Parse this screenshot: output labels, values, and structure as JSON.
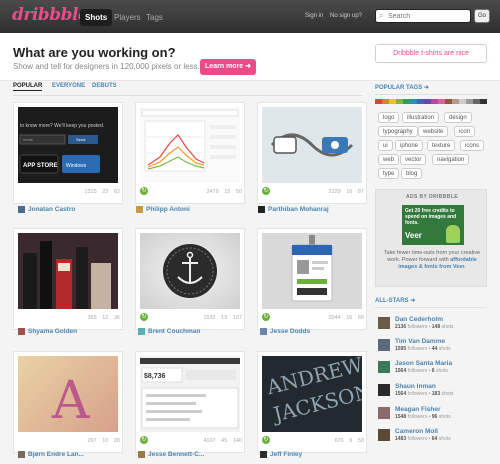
{
  "header": {
    "logo": "dribbble",
    "nav": [
      "Shots",
      "Players",
      "Tags"
    ],
    "sign_in": "Sign in",
    "no_signup": "No sign up?",
    "search_placeholder": "Search",
    "go_label": "Go"
  },
  "hero": {
    "title": "What are you working on?",
    "subtitle": "Show and tell for designers in 120,000 pixels or less.",
    "button": "Learn more ➜",
    "tshirts": "Dribbble t-shirts are nice"
  },
  "tabs": [
    "POPULAR",
    "EVERYONE",
    "DEBUTS"
  ],
  "shots": [
    {
      "views": "1325",
      "comments": "23",
      "likes": "62",
      "player": "Jonatan Castro"
    },
    {
      "views": "2479",
      "comments": "15",
      "likes": "50",
      "player": "Philipp Antoni"
    },
    {
      "views": "2129",
      "comments": "16",
      "likes": "87",
      "player": "Parthiban Mohanraj"
    },
    {
      "views": "365",
      "comments": "12",
      "likes": "36",
      "player": "Shyama Golden"
    },
    {
      "views": "1532",
      "comments": "13",
      "likes": "107",
      "player": "Brent Couchman"
    },
    {
      "views": "2044",
      "comments": "16",
      "likes": "69",
      "player": "Jesse Dodds"
    },
    {
      "views": "297",
      "comments": "10",
      "likes": "28",
      "player": "Bjørn Endre Lan..."
    },
    {
      "views": "4107",
      "comments": "45",
      "likes": "140",
      "player": "Jesse Bennett-C..."
    },
    {
      "views": "676",
      "comments": "9",
      "likes": "53",
      "player": "Jeff Finley"
    }
  ],
  "sidebar": {
    "popular_tags_heading": "POPULAR TAGS ➜",
    "tags": [
      "logo",
      "illustration",
      "design",
      "typography",
      "website",
      "icon",
      "ui",
      "iphone",
      "texture",
      "icons",
      "web",
      "vector",
      "navigation",
      "type",
      "blog"
    ],
    "palette": [
      "#e0413a",
      "#f07a2e",
      "#f4c21f",
      "#7ab93d",
      "#2f9d57",
      "#2b8fb8",
      "#3866b8",
      "#6a46a8",
      "#b54aa5",
      "#e060a0",
      "#8a5a3a",
      "#b0a08a",
      "#ccc",
      "#999",
      "#666",
      "#333"
    ],
    "ad_heading": "ADS BY DRIBBBLE",
    "ad_image_text": "Get 20 free credits to spend on images and fonts.",
    "ad_brand": "Veer",
    "ad_text_1": "Take fewer time-outs from your creative work. Power forward with",
    "ad_text_link": "affordable images & fonts from Veer.",
    "all_stars_heading": "ALL-STARS ➜",
    "stars": [
      {
        "name": "Dan Cederholm",
        "followers": "2136",
        "shots": "148"
      },
      {
        "name": "Tim Van Damme",
        "followers": "1595",
        "shots": "44"
      },
      {
        "name": "Jason Santa Maria",
        "followers": "1564",
        "shots": "6"
      },
      {
        "name": "Shaun Inman",
        "followers": "1564",
        "shots": "183"
      },
      {
        "name": "Meagan Fisher",
        "followers": "1548",
        "shots": "96"
      },
      {
        "name": "Cameron Moll",
        "followers": "1483",
        "shots": "64"
      }
    ]
  }
}
